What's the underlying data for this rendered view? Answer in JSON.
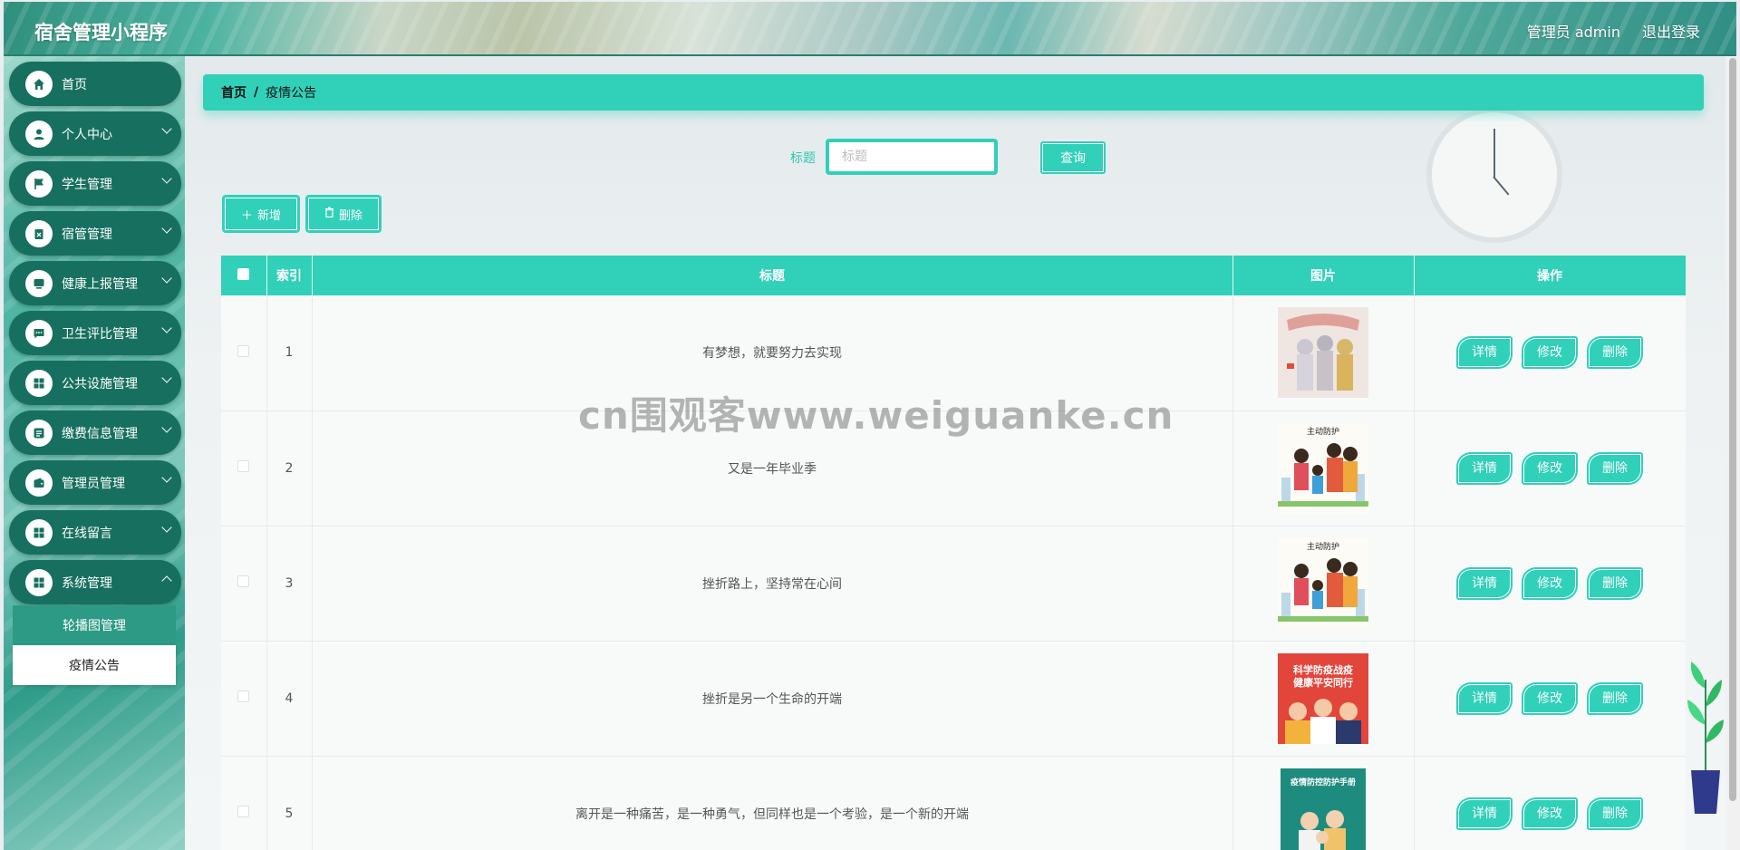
{
  "header": {
    "app_title": "宿舍管理小程序",
    "admin_label": "管理员 admin",
    "logout_label": "退出登录"
  },
  "sidebar": {
    "items": [
      {
        "label": "首页",
        "icon": "home-icon",
        "has_submenu": false
      },
      {
        "label": "个人中心",
        "icon": "user-icon",
        "has_submenu": true
      },
      {
        "label": "学生管理",
        "icon": "flag-icon",
        "has_submenu": true
      },
      {
        "label": "宿管管理",
        "icon": "clipboard-icon",
        "has_submenu": true
      },
      {
        "label": "健康上报管理",
        "icon": "monitor-icon",
        "has_submenu": true
      },
      {
        "label": "卫生评比管理",
        "icon": "chat-icon",
        "has_submenu": true
      },
      {
        "label": "公共设施管理",
        "icon": "grid-icon",
        "has_submenu": true
      },
      {
        "label": "缴费信息管理",
        "icon": "list-icon",
        "has_submenu": true
      },
      {
        "label": "管理员管理",
        "icon": "wallet-icon",
        "has_submenu": true
      },
      {
        "label": "在线留言",
        "icon": "grid-icon",
        "has_submenu": true
      },
      {
        "label": "系统管理",
        "icon": "grid-icon",
        "has_submenu": true
      }
    ],
    "sub_items": [
      {
        "label": "轮播图管理",
        "active": false
      },
      {
        "label": "疫情公告",
        "active": true
      }
    ]
  },
  "breadcrumb": {
    "home": "首页",
    "separator": "/",
    "current": "疫情公告"
  },
  "search": {
    "label": "标题",
    "placeholder": "标题",
    "button": "查询"
  },
  "toolbar": {
    "add_label": "新增",
    "delete_label": "删除"
  },
  "table": {
    "columns": [
      "索引",
      "标题",
      "图片",
      "操作"
    ],
    "rows": [
      {
        "index": "1",
        "title": "有梦想，就要努力去实现",
        "image": "poster-doctors"
      },
      {
        "index": "2",
        "title": "又是一年毕业季",
        "image": "poster-family-masks"
      },
      {
        "index": "3",
        "title": "挫折路上，坚持常在心间",
        "image": "poster-family-masks"
      },
      {
        "index": "4",
        "title": "挫折是另一个生命的开端",
        "image": "poster-red-prevention"
      },
      {
        "index": "5",
        "title": "离开是一种痛苦，是一种勇气，但同样也是一个考验，是一个新的开端",
        "image": "poster-handbook"
      }
    ],
    "actions": [
      "详情",
      "修改",
      "删除"
    ]
  },
  "watermark": "cn围观客www.weiguanke.cn",
  "image_texts": {
    "poster2_title": "主动防护",
    "poster4_line1": "科学防疫战疫",
    "poster4_line2": "健康平安同行",
    "poster5_title": "疫情防控防护手册"
  },
  "colors": {
    "accent": "#31d0b9",
    "sidebar_item": "#17705f",
    "submenu_active": "#2c9a84"
  }
}
